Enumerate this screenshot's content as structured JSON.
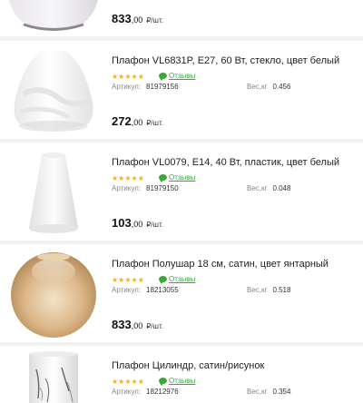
{
  "products": [
    {
      "title": "",
      "stars": "★★★★★",
      "reviews_label": "",
      "article_label": "",
      "article": "",
      "weight_label": "",
      "weight": "",
      "price_main": "833",
      "price_cents": ",00",
      "price_unit": "₽/шт."
    },
    {
      "title": "Плафон VL6831P, E27, 60 Вт, стекло, цвет белый",
      "stars": "★★★★★",
      "reviews_label": "Отзывы",
      "article_label": "Артикул:",
      "article": "81979156",
      "weight_label": "Вес,кг",
      "weight": "0.456",
      "price_main": "272",
      "price_cents": ",00",
      "price_unit": "₽/шт."
    },
    {
      "title": "Плафон VL0079, E14, 40 Вт, пластик, цвет белый",
      "stars": "★★★★★",
      "reviews_label": "Отзывы",
      "article_label": "Артикул:",
      "article": "81979150",
      "weight_label": "Вес,кг",
      "weight": "0.048",
      "price_main": "103",
      "price_cents": ",00",
      "price_unit": "₽/шт."
    },
    {
      "title": "Плафон Полушар 18 см, сатин, цвет янтарный",
      "stars": "★★★★★",
      "reviews_label": "Отзывы",
      "article_label": "Артикул:",
      "article": "18213055",
      "weight_label": "Вес,кг",
      "weight": "0.518",
      "price_main": "833",
      "price_cents": ",00",
      "price_unit": "₽/шт."
    },
    {
      "title": "Плафон Цилиндр, сатин/рисунок",
      "stars": "★★★★★",
      "reviews_label": "Отзывы",
      "article_label": "Артикул:",
      "article": "18212976",
      "weight_label": "Вес,кг",
      "weight": "0.354",
      "price_main": "",
      "price_cents": "",
      "price_unit": ""
    }
  ],
  "icons": {
    "rating": "star-icon",
    "reviews": "chat-bubble-icon"
  },
  "colors": {
    "accent_green": "#3aa83a",
    "star_yellow": "#f5b400",
    "amber_shade": "#c8955a"
  }
}
